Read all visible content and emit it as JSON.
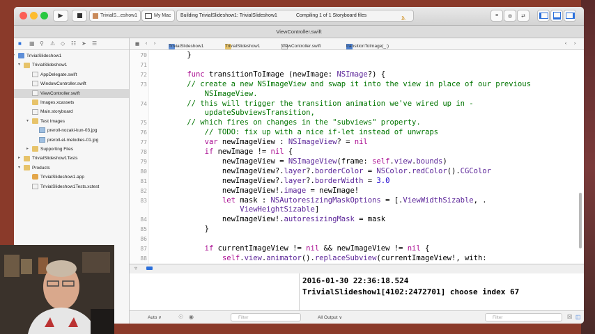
{
  "toolbar": {
    "scheme": "TrivialS...eshow1",
    "destination": "My Mac",
    "status_building": "Building TrivialSlideshow1: TrivialSlideshow1",
    "status_compiling": "Compiling 1 of 1 Storyboard files",
    "warning_count": "1"
  },
  "tab_title": "ViewController.swift",
  "navigator": {
    "items": [
      {
        "label": "TrivialSlideshow1",
        "icon": "project-icon"
      },
      {
        "label": "TrivialSlideshow1",
        "icon": "folder-icon"
      },
      {
        "label": "AppDelegate.swift",
        "icon": "swift-file-icon"
      },
      {
        "label": "WindowController.swift",
        "icon": "swift-file-icon"
      },
      {
        "label": "ViewController.swift",
        "icon": "swift-file-icon",
        "selected": true
      },
      {
        "label": "Images.xcassets",
        "icon": "folder-icon"
      },
      {
        "label": "Main.storyboard",
        "icon": "storyboard-icon"
      },
      {
        "label": "Test Images",
        "icon": "folder-icon"
      },
      {
        "label": "preroll-nozaki-kun-03.jpg",
        "icon": "image-file-icon"
      },
      {
        "label": "preroll-el-melodies-01.jpg",
        "icon": "image-file-icon"
      },
      {
        "label": "Supporting Files",
        "icon": "folder-icon"
      },
      {
        "label": "TrivialSlideshow1Tests",
        "icon": "folder-icon"
      },
      {
        "label": "Products",
        "icon": "folder-icon"
      },
      {
        "label": "TrivialSlideshow1.app",
        "icon": "app-icon"
      },
      {
        "label": "TrivialSlideshow1Tests.xctest",
        "icon": "swift-file-icon"
      }
    ]
  },
  "jumpbar": {
    "crumbs": [
      "TrivialSlideshow1",
      "TrivialSlideshow1",
      "ViewController.swift",
      "transitionToImage(_:)"
    ]
  },
  "code": {
    "line_numbers": [
      "70",
      "71",
      "72",
      "73",
      "",
      "74",
      "",
      "75",
      "76",
      "77",
      "78",
      "79",
      "80",
      "81",
      "82",
      "83",
      "",
      "84",
      "85",
      "86",
      "87",
      "88"
    ],
    "lines": [
      "    }",
      "",
      "    func transitionToImage (newImage: NSImage?) {",
      "    // create a new NSImageView and swap it into the view in place of our previous",
      "        NSImageView.",
      "    // this will trigger the transition animation we've wired up in -",
      "        updateSubviewsTransition,",
      "    // which fires on changes in the \"subviews\" property.",
      "        // TODO: fix up with a nice if-let instead of unwraps",
      "        var newImageView : NSImageView? = nil",
      "        if newImage != nil {",
      "            newImageView = NSImageView(frame: self.view.bounds)",
      "            newImageView?.layer?.borderColor = NSColor.redColor().CGColor",
      "            newImageView?.layer?.borderWidth = 3.0",
      "            newImageView!.image = newImage!",
      "            let mask : NSAutoresizingMaskOptions = [.ViewWidthSizable, .",
      "                ViewHeightSizable]",
      "            newImageView!.autoresizingMask = mask",
      "        }",
      "",
      "        if currentImageView != nil && newImageView != nil {",
      "            self.view.animator().replaceSubview(currentImageView!, with:"
    ]
  },
  "console": {
    "line1": "2016-01-30 22:36:18.524",
    "line2": "TrivialSlideshow1[4102:2472701] choose index 67"
  },
  "bottom": {
    "auto_label": "Auto ∨",
    "filter_placeholder": "Filter",
    "output_label": "All Output ∨"
  },
  "colors": {
    "keyword": "#aa0d91",
    "comment": "#007400",
    "type": "#5c2699",
    "number": "#1c00cf"
  }
}
